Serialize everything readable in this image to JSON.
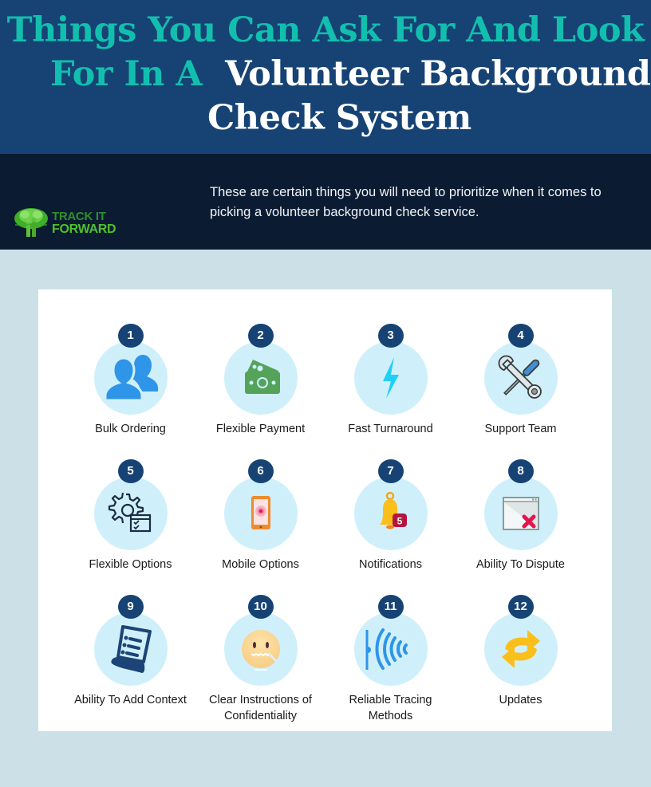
{
  "header": {
    "title_line1": "Things You Can Ask For And Look",
    "title_line2_accent": "For In A",
    "title_line2_white": "Volunteer Background",
    "title_line3": "Check System"
  },
  "intro": {
    "text": "These are certain things you will need to prioritize when it comes to picking a volunteer background check service."
  },
  "logo": {
    "line1": "TRACK IT",
    "line2": "FORWARD",
    "icon": "tree-people-icon"
  },
  "colors": {
    "header_bg": "#164374",
    "title_accent": "#12bfae",
    "band_bg": "#0b1b32",
    "page_bg": "#cbe1e7",
    "badge_bg": "#164374",
    "icon_circle": "#cff0fb"
  },
  "items": [
    {
      "number": "1",
      "label": "Bulk Ordering",
      "icon": "users-icon"
    },
    {
      "number": "2",
      "label": "Flexible Payment",
      "icon": "money-icon"
    },
    {
      "number": "3",
      "label": "Fast Turnaround",
      "icon": "lightning-icon"
    },
    {
      "number": "4",
      "label": "Support Team",
      "icon": "tools-icon"
    },
    {
      "number": "5",
      "label": "Flexible Options",
      "icon": "gear-checklist-icon"
    },
    {
      "number": "6",
      "label": "Mobile Options",
      "icon": "mobile-phone-icon"
    },
    {
      "number": "7",
      "label": "Notifications",
      "icon": "bell-icon",
      "badge_count": "5"
    },
    {
      "number": "8",
      "label": "Ability To Dispute",
      "icon": "window-close-icon"
    },
    {
      "number": "9",
      "label": "Ability To Add Context",
      "icon": "document-list-icon"
    },
    {
      "number": "10",
      "label": "Clear Instructions of Confidentiality",
      "icon": "zipped-mouth-icon"
    },
    {
      "number": "11",
      "label": "Reliable Tracing Methods",
      "icon": "signal-waves-icon"
    },
    {
      "number": "12",
      "label": "Updates",
      "icon": "refresh-arrows-icon"
    }
  ]
}
